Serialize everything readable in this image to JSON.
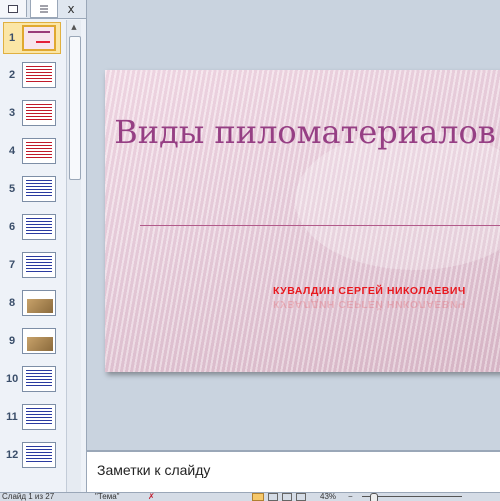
{
  "thumbnail_panel": {
    "tabs": {
      "slides_icon": "slides-tab-icon",
      "outline_icon": "outline-tab-icon",
      "close": "x"
    },
    "slides": [
      {
        "number": "1",
        "type": "title"
      },
      {
        "number": "2",
        "type": "red-text"
      },
      {
        "number": "3",
        "type": "red-text"
      },
      {
        "number": "4",
        "type": "red-text"
      },
      {
        "number": "5",
        "type": "text"
      },
      {
        "number": "6",
        "type": "text"
      },
      {
        "number": "7",
        "type": "text"
      },
      {
        "number": "8",
        "type": "image"
      },
      {
        "number": "9",
        "type": "image"
      },
      {
        "number": "10",
        "type": "text"
      },
      {
        "number": "11",
        "type": "text"
      },
      {
        "number": "12",
        "type": "text"
      }
    ],
    "scroll_up": "▲",
    "selected_slide": "1"
  },
  "slide": {
    "title": "Виды пиломатериалов",
    "author": "КУВАЛДИН   СЕРГЕЙ НИКОЛАЕВИЧ"
  },
  "notes": {
    "placeholder": "Заметки к слайду"
  },
  "status_bar": {
    "slide_info": "Слайд 1 из 27",
    "theme": "\"Тема\"",
    "spell_icon": "spellcheck-icon",
    "zoom": "43%",
    "zoom_out": "−"
  },
  "colors": {
    "title": "#963f84",
    "author": "#e8181e",
    "selected_border": "#e0a830"
  }
}
